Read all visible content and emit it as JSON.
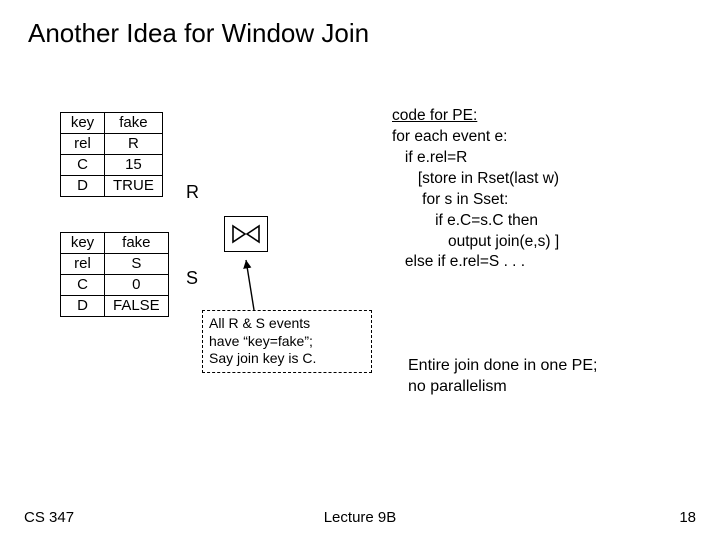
{
  "title": "Another Idea for Window Join",
  "tableR": {
    "rows": [
      [
        "key",
        "fake"
      ],
      [
        "rel",
        "R"
      ],
      [
        "C",
        "15"
      ],
      [
        "D",
        "TRUE"
      ]
    ]
  },
  "tableS": {
    "rows": [
      [
        "key",
        "fake"
      ],
      [
        "rel",
        "S"
      ],
      [
        "C",
        "0"
      ],
      [
        "D",
        "FALSE"
      ]
    ]
  },
  "inputR": "R",
  "inputS": "S",
  "note": {
    "l1": "All R & S events",
    "l2": "have “key=fake”;",
    "l3": "Say join key is C."
  },
  "code": {
    "l0": "code for PE:",
    "l1": "for each event e:",
    "l2": "   if e.rel=R",
    "l3": "      [store in Rset(last w)",
    "l4": "       for s in Sset:",
    "l5": "          if e.C=s.C then",
    "l6": "             output join(e,s) ]",
    "l7": "   else if e.rel=S . . ."
  },
  "comment": {
    "l1": "Entire join done in one PE;",
    "l2": "no parallelism"
  },
  "footer": {
    "left": "CS 347",
    "center": "Lecture 9B",
    "right": "18"
  }
}
